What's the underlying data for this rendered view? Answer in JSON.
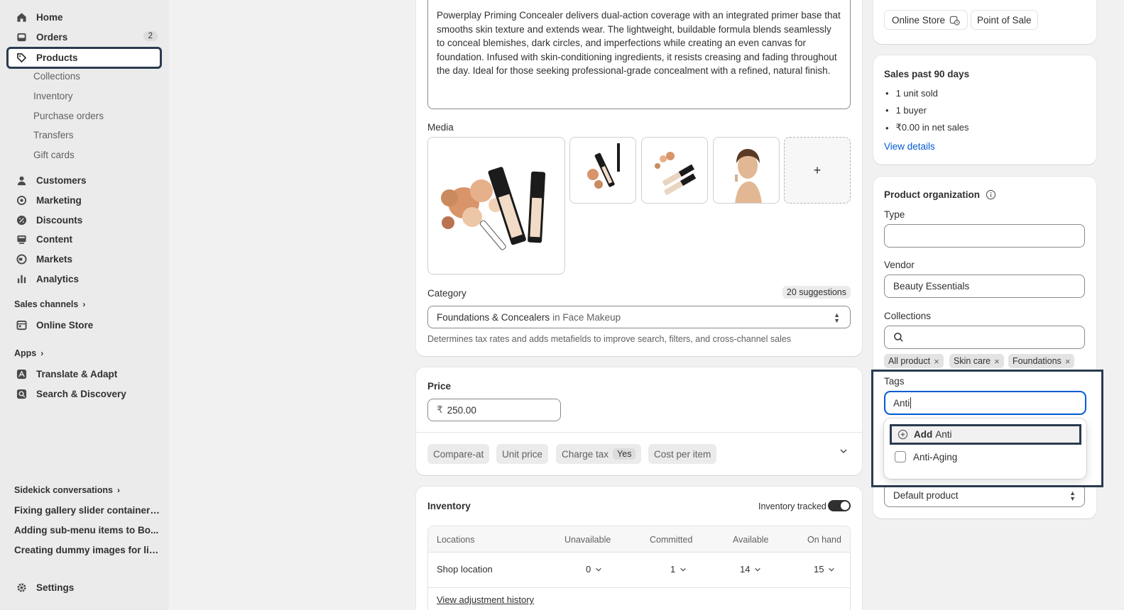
{
  "sidebar": {
    "home": "Home",
    "orders": "Orders",
    "orders_badge": "2",
    "products": "Products",
    "sub": [
      "Collections",
      "Inventory",
      "Purchase orders",
      "Transfers",
      "Gift cards"
    ],
    "customers": "Customers",
    "marketing": "Marketing",
    "discounts": "Discounts",
    "content": "Content",
    "markets": "Markets",
    "analytics": "Analytics",
    "sales_channels": "Sales channels",
    "online_store": "Online Store",
    "apps": "Apps",
    "translate": "Translate & Adapt",
    "search_discovery": "Search & Discovery",
    "sidekick": "Sidekick conversations",
    "conversations": [
      "Fixing gallery slider container i...",
      "Adding sub-menu items to Bo...",
      "Creating dummy images for lip..."
    ],
    "settings": "Settings"
  },
  "main": {
    "description": "Powerplay Priming Concealer delivers dual-action coverage with an integrated primer base that smooths skin texture and extends wear. The lightweight, buildable formula blends seamlessly to conceal blemishes, dark circles, and imperfections while creating an even canvas for foundation. Infused with skin-conditioning ingredients, it resists creasing and fading throughout the day. Ideal for those seeking professional-grade concealment with a refined, natural finish.",
    "media_label": "Media",
    "media_add": "+",
    "category_label": "Category",
    "category_suggestions": "20 suggestions",
    "category_value": "Foundations & Concealers",
    "category_in": "in Face Makeup",
    "category_help": "Determines tax rates and adds metafields to improve search, filters, and cross-channel sales",
    "price_label": "Price",
    "currency": "₹",
    "price_value": "250.00",
    "pills": {
      "compare_at": "Compare-at",
      "unit_price": "Unit price",
      "charge_tax": "Charge tax",
      "charge_tax_value": "Yes",
      "cost_per_item": "Cost per item"
    },
    "inventory": {
      "title": "Inventory",
      "tracked_label": "Inventory tracked",
      "columns": [
        "Locations",
        "Unavailable",
        "Committed",
        "Available",
        "On hand"
      ],
      "row": {
        "location": "Shop location",
        "unavailable": "0",
        "committed": "1",
        "available": "14",
        "on_hand": "15"
      },
      "history_link": "View adjustment history"
    }
  },
  "right": {
    "channels": [
      "Online Store",
      "Point of Sale"
    ],
    "sales": {
      "title": "Sales past 90 days",
      "items": [
        "1 unit sold",
        "1 buyer",
        "₹0.00 in net sales"
      ],
      "link": "View details"
    },
    "org": {
      "title": "Product organization",
      "type_label": "Type",
      "type_value": "",
      "vendor_label": "Vendor",
      "vendor_value": "Beauty Essentials",
      "collections_label": "Collections",
      "collection_tags": [
        "All product",
        "Skin care",
        "Foundations"
      ],
      "tags_label": "Tags",
      "tags_value": "Anti",
      "dropdown_add_prefix": "Add",
      "dropdown_add_value": "Anti",
      "dropdown_option": "Anti-Aging",
      "template_value": "Default product"
    }
  },
  "colors": {
    "accent": "#005bd3",
    "highlight": "#2a3b4f",
    "sidebar": "#ebebeb"
  }
}
